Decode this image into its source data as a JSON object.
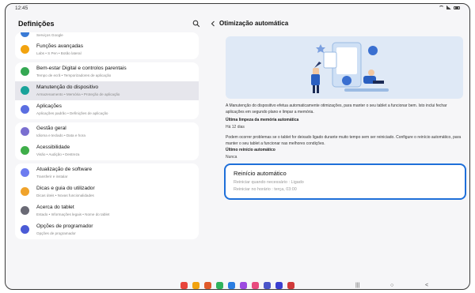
{
  "status": {
    "time": "12:45"
  },
  "left": {
    "title": "Definições",
    "items": [
      {
        "title": "",
        "sub": "Serviços Google",
        "color": "#3a7bd5",
        "partial": true
      },
      {
        "title": "Funções avançadas",
        "sub": "Labs • S Pen • Botão lateral",
        "color": "#f2a30f"
      },
      {
        "title": "Bem-estar Digital e controlos parentais",
        "sub": "Tempo de ecrã • Temporizadores de aplicação",
        "color": "#35a853"
      },
      {
        "title": "Manutenção do dispositivo",
        "sub": "Armazenamento • Memória • Proteção de aplicação",
        "color": "#1aa39a",
        "selected": true
      },
      {
        "title": "Aplicações",
        "sub": "Aplicações padrão • Definições de aplicação",
        "color": "#5b6ee1"
      },
      {
        "title": "Gestão geral",
        "sub": "Idioma e teclado • Data e hora",
        "color": "#7a6fd0"
      },
      {
        "title": "Acessibilidade",
        "sub": "Visão • Audição • Destreza",
        "color": "#3fae4a"
      },
      {
        "title": "Atualização de software",
        "sub": "Transferir e instalar",
        "color": "#6d7cf0"
      },
      {
        "title": "Dicas e guia do utilizador",
        "sub": "Dicas úteis • Novas funcionalidades",
        "color": "#f0a32b"
      },
      {
        "title": "Acerca do tablet",
        "sub": "Estado • Informações legais • Nome do tablet",
        "color": "#6a6a75"
      },
      {
        "title": "Opções de programador",
        "sub": "Opções de programador",
        "color": "#4b5bd6"
      }
    ]
  },
  "right": {
    "title": "Otimização automática",
    "description": "A Manutenção do dispositivo efetua automaticamente otimizações, para manter o seu tablet a funcionar bem. Isto inclui fechar aplicações em segundo plano e limpar a memória.",
    "last_clean_label": "Última limpeza da memória automática",
    "last_clean_value": "Há 12 dias",
    "restart_paragraph": "Podem ocorrer problemas se o tablet for deixado ligado durante muito tempo sem ser reiniciado. Configure o reinício automático, para manter o seu tablet a funcionar nas melhores condições.",
    "last_restart_label": "Último reinício automático",
    "last_restart_value": "Nunca",
    "restart_card": {
      "title": "Reinício automático",
      "line1": "Reiniciar quando necessário : Ligado",
      "line2": "Reiniciar no horário : terça, 03:00"
    }
  },
  "dock": {
    "apps": [
      {
        "name": "apps-grid",
        "color": "#e8453c"
      },
      {
        "name": "files",
        "color": "#f2a30f"
      },
      {
        "name": "notes",
        "color": "#e05a2a"
      },
      {
        "name": "messages",
        "color": "#2fb35c"
      },
      {
        "name": "phone-link",
        "color": "#2a7de1"
      },
      {
        "name": "galaxy-store",
        "color": "#9c4ae0"
      },
      {
        "name": "calendar",
        "color": "#e84a7f"
      },
      {
        "name": "teams",
        "color": "#4a55c9"
      },
      {
        "name": "settings",
        "color": "#3a3fd0"
      },
      {
        "name": "camera",
        "color": "#d03a3a"
      }
    ]
  },
  "nav": {
    "recent": "|||",
    "home": "○",
    "back": "<"
  }
}
